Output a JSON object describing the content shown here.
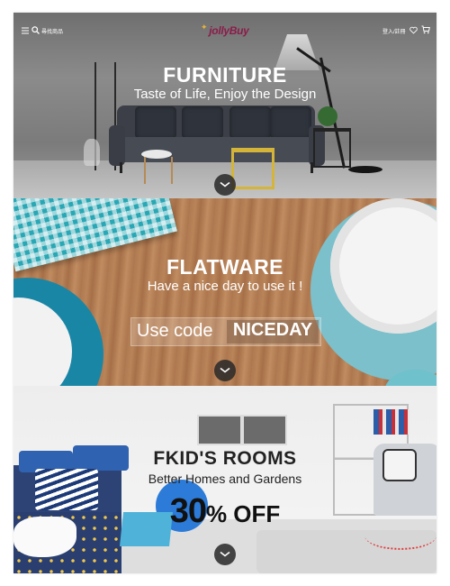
{
  "header": {
    "search_label": "尋找商品",
    "logo_text": "jollyBuy",
    "login_label": "登入/註冊",
    "icons": [
      "menu-icon",
      "search-icon",
      "heart-icon",
      "cart-icon"
    ]
  },
  "banners": [
    {
      "title": "FURNITURE",
      "subtitle": "Taste of Life, Enjoy the Design"
    },
    {
      "title": "FLATWARE",
      "subtitle": "Have a nice day to use it !",
      "code_prefix": "Use code",
      "code_value": "NICEDAY"
    },
    {
      "title": "FKID'S ROOMS",
      "subtitle": "Better Homes and Gardens",
      "offer_number": "30",
      "offer_suffix": "% OFF"
    }
  ],
  "colors": {
    "logo": "#8a1c4a",
    "logo_mark": "#e8b33a",
    "scroll_button": "#282828"
  }
}
